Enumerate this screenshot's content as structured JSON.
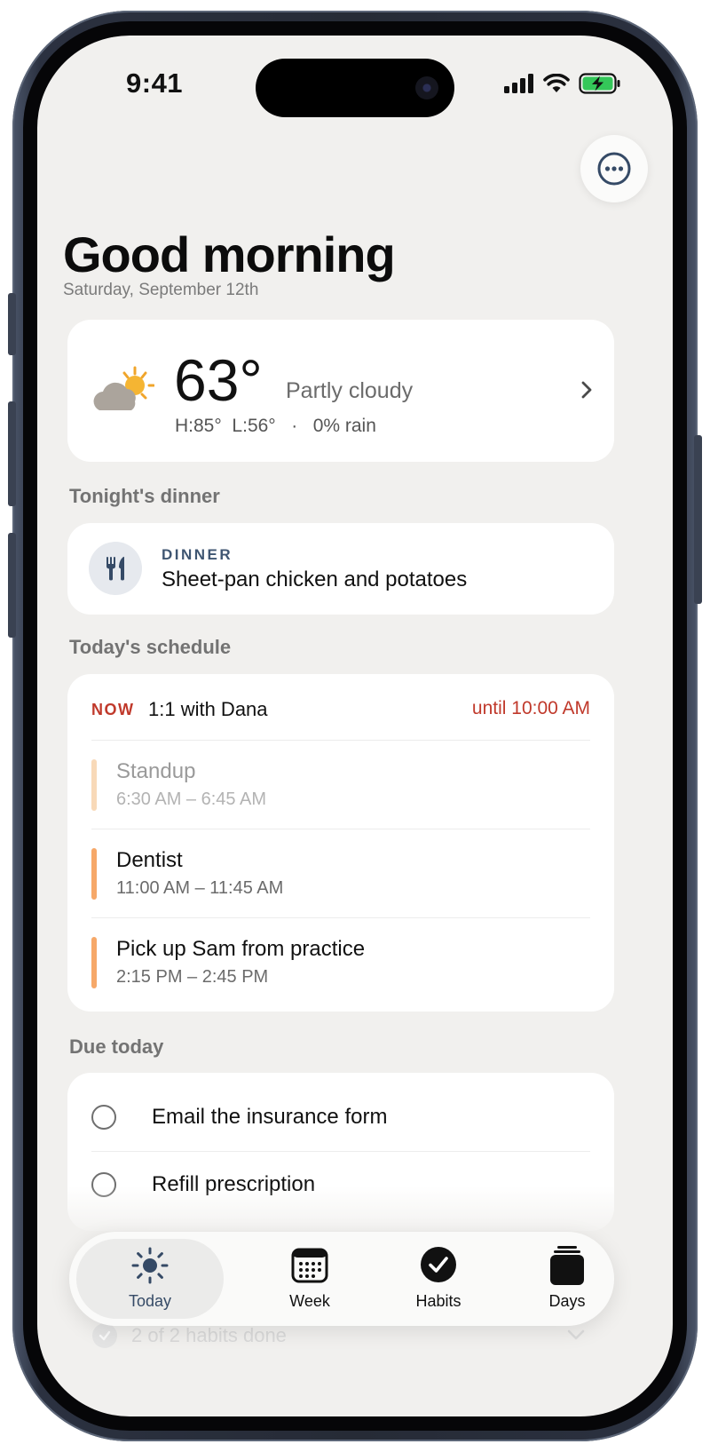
{
  "status_bar": {
    "time": "9:41"
  },
  "header": {
    "greeting": "Good morning",
    "date": "Saturday, September 12th",
    "menu_icon": "ellipsis-circle-icon"
  },
  "weather": {
    "temperature": "63°",
    "condition": "Partly cloudy",
    "details": "H:85°  L:56°   ·   0% rain",
    "icon": "partly-cloudy-icon"
  },
  "dinner": {
    "section_label": "Tonight's dinner",
    "kicker": "DINNER",
    "title": "Sheet-pan chicken and potatoes",
    "icon": "fork-knife-icon"
  },
  "schedule": {
    "section_label": "Today's schedule",
    "now": {
      "badge": "NOW",
      "title": "1:1 with Dana",
      "until": "until 10:00 AM"
    },
    "events": [
      {
        "title": "Standup",
        "time": "6:30 AM – 6:45 AM",
        "status": "past",
        "color": "#f8d9b8"
      },
      {
        "title": "Dentist",
        "time": "11:00 AM – 11:45 AM",
        "status": "upcoming",
        "color": "#f6a869"
      },
      {
        "title": "Pick up Sam from practice",
        "time": "2:15 PM – 2:45 PM",
        "status": "upcoming",
        "color": "#f6a869"
      }
    ]
  },
  "due_today": {
    "section_label": "Due today",
    "items": [
      {
        "label": "Email the insurance form",
        "done": false
      },
      {
        "label": "Refill prescription",
        "done": false
      }
    ]
  },
  "habits_peek": {
    "text": "2 of 2 habits done"
  },
  "tabbar": {
    "tabs": [
      {
        "label": "Today",
        "icon": "sun-icon",
        "active": true
      },
      {
        "label": "Week",
        "icon": "calendar-icon",
        "active": false
      },
      {
        "label": "Habits",
        "icon": "checkmark-circle-icon",
        "active": false
      },
      {
        "label": "Days",
        "icon": "stack-icon",
        "active": false
      }
    ]
  },
  "colors": {
    "accent": "#354a66",
    "now_red": "#c0392b",
    "event_orange": "#f6a869",
    "background": "#f1f0ee"
  }
}
